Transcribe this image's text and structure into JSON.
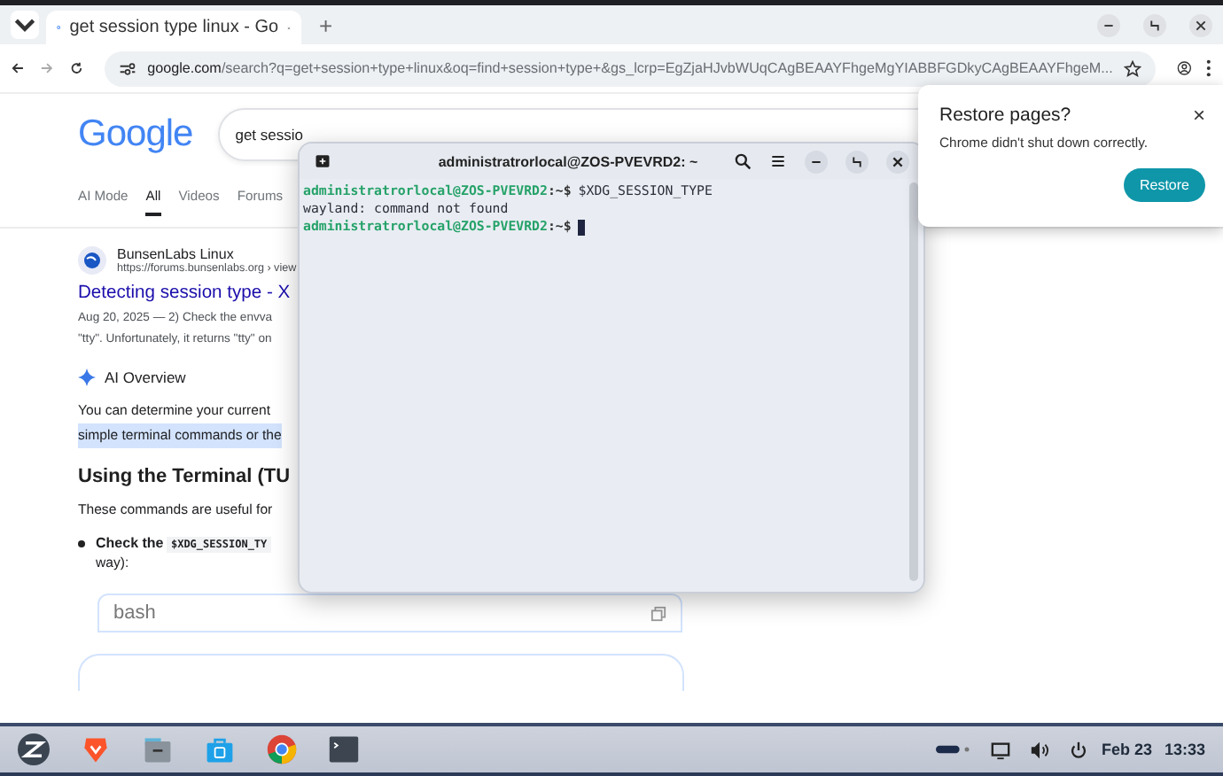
{
  "browser": {
    "tabs": [
      {
        "title": "get session type linux - Go",
        "selected": true
      }
    ],
    "new_tab": "+",
    "address": {
      "host": "google.com",
      "rest": "/search?q=get+session+type+linux&oq=find+session+type+&gs_lcrp=EgZjaHJvbWUqCAgBEAAYFhgeMgYIABBFGDkyCAgBEAAYFhgeM..."
    }
  },
  "google": {
    "logo": "Google",
    "query": "get sessio",
    "filters": [
      {
        "label": "AI Mode",
        "selected": false
      },
      {
        "label": "All",
        "selected": true
      },
      {
        "label": "Videos",
        "selected": false
      },
      {
        "label": "Forums",
        "selected": false
      }
    ],
    "result": {
      "site": "BunsenLabs Linux",
      "url": "https://forums.bunsenlabs.org › view",
      "title": "Detecting session type - X",
      "snippet": [
        "Aug 20, 2025 — 2) Check the envva",
        "\"tty\". Unfortunately, it returns \"tty\" on"
      ]
    },
    "ai_overview": {
      "label": "AI Overview",
      "intro": "You can determine your current",
      "highlight": "simple terminal commands or the",
      "heading": "Using the Terminal (TU",
      "para": "These commands are useful for",
      "bullet_bold": "Check the",
      "bullet_code": "$XDG_SESSION_TY",
      "bullet_rest": "way):",
      "code_lang": "bash"
    }
  },
  "terminal": {
    "title": "administratrorlocal@ZOS-PVEVRD2: ~",
    "lines": [
      {
        "kind": "prompt",
        "user": "administratrorlocal@ZOS-PVEVRD2",
        "path": ":~$",
        "command": "$XDG_SESSION_TYPE"
      },
      {
        "kind": "output",
        "text": "wayland: command not found"
      },
      {
        "kind": "prompt",
        "user": "administratrorlocal@ZOS-PVEVRD2",
        "path": ":~$",
        "cursor": true
      }
    ]
  },
  "restore_popup": {
    "title": "Restore pages?",
    "close": "×",
    "message": "Chrome didn't shut down correctly.",
    "button": "Restore"
  },
  "taskbar": {
    "date": "Feb 23",
    "time": "13:33"
  }
}
